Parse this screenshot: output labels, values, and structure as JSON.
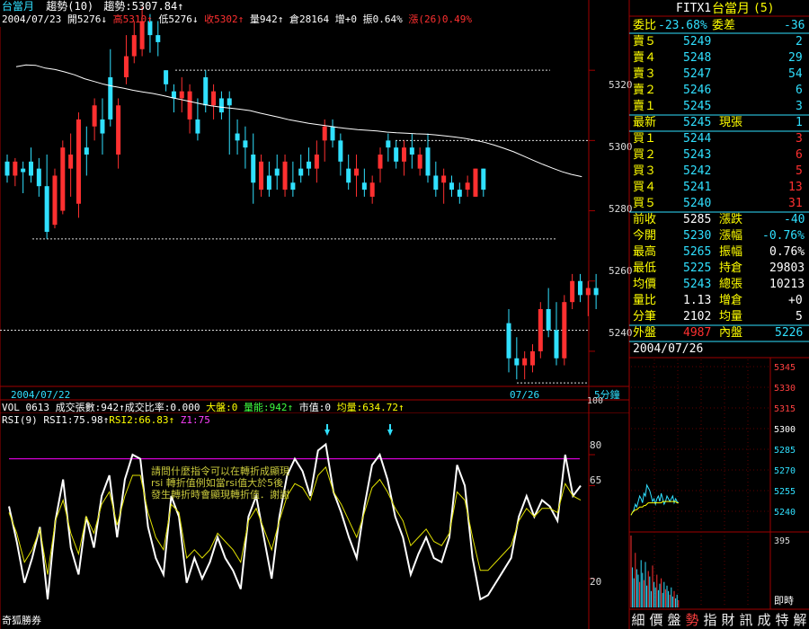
{
  "main_header": {
    "symbol": "台當月",
    "trend_label": "趨勢(10)",
    "trend_value": "趨勢:5307.84↑",
    "date": "2004/07/23",
    "open": "開5276↓",
    "high": "高5310↑",
    "low": "低5276↓",
    "close": "收5302↑",
    "volume": "量942↑",
    "oi": "倉28164",
    "oi_change": "增+0",
    "amplitude": "振0.64%",
    "change": "漲(26)0.49%"
  },
  "price_axis": [
    "5320",
    "5300",
    "5280",
    "5260",
    "5240"
  ],
  "date_axis": {
    "left": "2004/07/22",
    "right": "07/26",
    "period": "5分鐘",
    "top_tick": "100"
  },
  "volume_bar": {
    "code": "VOL 0613",
    "contracts": "成交張數:942↑",
    "ratio": "成交比率:0.000",
    "market": "大盤:0",
    "energy": "量能:942↑",
    "value": "市值:0",
    "avg": "均量:634.72↑"
  },
  "rsi_header": {
    "name": "RSI(9)",
    "rsi1": "RSI1:75.98↑",
    "rsi2": "RSI2:66.83↑",
    "z": "Z1:75"
  },
  "rsi_axis": [
    "80",
    "65",
    "20"
  ],
  "annotation": [
    "請問什麼指令可以在轉折成顯現",
    "rsi 轉折值例如當rsi值大於5後",
    "發生轉折時會顯現轉折值．謝謝"
  ],
  "footer_brand": "奇狐勝券",
  "quote": {
    "code": "FITX1",
    "name": "台當月",
    "count": "(5)",
    "ratio_label": "委比",
    "ratio_value": "-23.68%",
    "diff_label": "委差",
    "diff_value": "-36",
    "asks": [
      {
        "label": "賣５",
        "price": "5249",
        "qty": "2"
      },
      {
        "label": "賣４",
        "price": "5248",
        "qty": "29"
      },
      {
        "label": "賣３",
        "price": "5247",
        "qty": "54"
      },
      {
        "label": "賣２",
        "price": "5246",
        "qty": "6"
      },
      {
        "label": "賣１",
        "price": "5245",
        "qty": "3"
      }
    ],
    "last": {
      "label": "最新",
      "price": "5245",
      "qlabel": "現張",
      "qty": "1"
    },
    "bids": [
      {
        "label": "買１",
        "price": "5244",
        "qty": "3"
      },
      {
        "label": "買２",
        "price": "5243",
        "qty": "6"
      },
      {
        "label": "買３",
        "price": "5242",
        "qty": "5"
      },
      {
        "label": "買４",
        "price": "5241",
        "qty": "13"
      },
      {
        "label": "買５",
        "price": "5240",
        "qty": "31"
      }
    ],
    "stats": [
      {
        "l1": "前收",
        "v1": "5285",
        "l2": "漲跌",
        "v2": "-40"
      },
      {
        "l1": "今開",
        "v1": "5230",
        "l2": "漲幅",
        "v2": "-0.76%"
      },
      {
        "l1": "最高",
        "v1": "5265",
        "l2": "振幅",
        "v2": "0.76%"
      },
      {
        "l1": "最低",
        "v1": "5225",
        "l2": "持倉",
        "v2": "29803"
      },
      {
        "l1": "均價",
        "v1": "5243",
        "l2": "總張",
        "v2": "10213"
      },
      {
        "l1": "量比",
        "v1": "1.13",
        "l2": "增倉",
        "v2": "+0"
      },
      {
        "l1": "分筆",
        "v1": "2102",
        "l2": "均量",
        "v2": "5"
      }
    ],
    "outer_label": "外盤",
    "outer_value": "4987",
    "inner_label": "內盤",
    "inner_value": "5226",
    "date": "2004/07/26"
  },
  "mini_axis": [
    "5345",
    "5330",
    "5315",
    "5300",
    "5285",
    "5270",
    "5255",
    "5240"
  ],
  "mini_vol_axis": {
    "max": "395",
    "label": "即時"
  },
  "bottom_nav": [
    "細",
    "價",
    "盤",
    "勢",
    "指",
    "財",
    "訊",
    "成",
    "特",
    "解"
  ],
  "bottom_nav_active": 3,
  "colors": {
    "up": "#ff3030",
    "down": "#30e0ff",
    "ma": "#ffffff",
    "rsi1": "#ffffff",
    "rsi2": "#e0e000",
    "zline": "#ff00ff",
    "border": "#a00000"
  },
  "chart_data": [
    {
      "type": "candlestick",
      "title": "台當月 趨勢(10)",
      "ylim": [
        5230,
        5340
      ],
      "series": [
        {
          "name": "candles",
          "values": [
            [
              5294,
              5296,
              5288,
              5290
            ],
            [
              5290,
              5295,
              5287,
              5294
            ],
            [
              5292,
              5294,
              5285,
              5291
            ],
            [
              5294,
              5298,
              5288,
              5290
            ],
            [
              5292,
              5295,
              5284,
              5287
            ],
            [
              5287,
              5296,
              5272,
              5274
            ],
            [
              5276,
              5292,
              5275,
              5290
            ],
            [
              5280,
              5300,
              5279,
              5298
            ],
            [
              5292,
              5302,
              5284,
              5296
            ],
            [
              5282,
              5308,
              5278,
              5306
            ],
            [
              5298,
              5304,
              5290,
              5296
            ],
            [
              5304,
              5312,
              5300,
              5310
            ],
            [
              5306,
              5312,
              5296,
              5302
            ],
            [
              5318,
              5326,
              5304,
              5306
            ],
            [
              5296,
              5312,
              5292,
              5310
            ],
            [
              5318,
              5330,
              5316,
              5324
            ],
            [
              5324,
              5334,
              5322,
              5330
            ],
            [
              5326,
              5338,
              5324,
              5334
            ],
            [
              5334,
              5336,
              5325,
              5330
            ],
            [
              5330,
              5334,
              5324,
              5328
            ],
            [
              5320,
              5320,
              5314,
              5316
            ],
            [
              5314,
              5316,
              5308,
              5312
            ],
            [
              5312,
              5318,
              5308,
              5314
            ],
            [
              5306,
              5316,
              5302,
              5314
            ],
            [
              5306,
              5312,
              5300,
              5302
            ],
            [
              5318,
              5320,
              5308,
              5310
            ],
            [
              5310,
              5316,
              5306,
              5314
            ],
            [
              5312,
              5314,
              5306,
              5308
            ],
            [
              5312,
              5314,
              5296,
              5310
            ],
            [
              5302,
              5306,
              5296,
              5300
            ],
            [
              5300,
              5304,
              5292,
              5298
            ],
            [
              5296,
              5302,
              5282,
              5288
            ],
            [
              5286,
              5296,
              5284,
              5294
            ],
            [
              5290,
              5294,
              5284,
              5286
            ],
            [
              5292,
              5296,
              5286,
              5290
            ],
            [
              5286,
              5296,
              5284,
              5294
            ],
            [
              5288,
              5294,
              5284,
              5286
            ],
            [
              5292,
              5296,
              5288,
              5290
            ],
            [
              5294,
              5298,
              5290,
              5292
            ],
            [
              5292,
              5300,
              5288,
              5296
            ],
            [
              5300,
              5306,
              5294,
              5304
            ],
            [
              5304,
              5306,
              5298,
              5300
            ],
            [
              5300,
              5302,
              5290,
              5294
            ],
            [
              5292,
              5296,
              5286,
              5288
            ],
            [
              5290,
              5296,
              5284,
              5292
            ],
            [
              5288,
              5292,
              5284,
              5286
            ],
            [
              5284,
              5290,
              5282,
              5288
            ],
            [
              5292,
              5298,
              5288,
              5296
            ],
            [
              5300,
              5302,
              5294,
              5298
            ],
            [
              5298,
              5300,
              5292,
              5294
            ],
            [
              5294,
              5300,
              5290,
              5298
            ],
            [
              5298,
              5302,
              5292,
              5296
            ],
            [
              5292,
              5298,
              5290,
              5296
            ],
            [
              5298,
              5302,
              5288,
              5290
            ],
            [
              5290,
              5294,
              5284,
              5286
            ],
            [
              5288,
              5292,
              5282,
              5290
            ],
            [
              5288,
              5290,
              5284,
              5286
            ],
            [
              5286,
              5288,
              5282,
              5284
            ],
            [
              5286,
              5290,
              5284,
              5288
            ],
            [
              5284,
              5292,
              5284,
              5292
            ],
            [
              5292,
              5292,
              5284,
              5286
            ],
            [
              5248,
              5252,
              5234,
              5238
            ],
            [
              5238,
              5244,
              5232,
              5236
            ],
            [
              5236,
              5240,
              5232,
              5238
            ],
            [
              5236,
              5242,
              5234,
              5240
            ],
            [
              5240,
              5254,
              5238,
              5252
            ],
            [
              5252,
              5258,
              5244,
              5246
            ],
            [
              5246,
              5254,
              5236,
              5238
            ],
            [
              5238,
              5256,
              5236,
              5254
            ],
            [
              5254,
              5262,
              5252,
              5260
            ],
            [
              5260,
              5262,
              5254,
              5256
            ],
            [
              5256,
              5260,
              5250,
              5258
            ],
            [
              5258,
              5262,
              5252,
              5256
            ]
          ]
        },
        {
          "name": "trend",
          "values": [
            5321,
            5321.5,
            5321.4,
            5320.6,
            5320.2,
            5319.5,
            5318.7,
            5317.6,
            5316.8,
            5316,
            5315.4,
            5314.9,
            5314.3,
            5313.8,
            5313.4,
            5312.8,
            5312.2,
            5311.6,
            5311,
            5310.4,
            5309.9,
            5309.5,
            5309.2,
            5308.9,
            5308.5,
            5307.8,
            5307.2,
            5306.6,
            5305.9,
            5305.4,
            5304.9,
            5304.5,
            5304.1,
            5303.7,
            5303.4,
            5303.1,
            5302.9,
            5302.7,
            5302.4,
            5302.2,
            5302.1,
            5301.9,
            5301.8,
            5301.6,
            5301.3,
            5301,
            5300.6,
            5300.1,
            5299.5,
            5298.7,
            5297.8,
            5296.8,
            5295.6,
            5294.4,
            5293.2,
            5292.1,
            5291.1,
            5290.3,
            5289.7
          ]
        }
      ]
    },
    {
      "type": "line",
      "title": "RSI(9)",
      "ylim": [
        0,
        100
      ],
      "series": [
        {
          "name": "RSI1",
          "values": [
            55,
            38,
            18,
            30,
            45,
            10,
            48,
            68,
            35,
            22,
            50,
            35,
            60,
            70,
            40,
            68,
            80,
            78,
            45,
            30,
            22,
            60,
            50,
            18,
            30,
            20,
            28,
            40,
            30,
            24,
            15,
            50,
            60,
            40,
            20,
            50,
            70,
            78,
            72,
            60,
            82,
            85,
            62,
            52,
            40,
            30,
            55,
            75,
            80,
            68,
            50,
            40,
            22,
            32,
            40,
            30,
            28,
            40,
            75,
            65,
            30,
            10,
            12,
            18,
            24,
            30,
            50,
            60,
            50,
            58,
            55,
            48,
            80,
            60,
            65
          ]
        },
        {
          "name": "RSI2",
          "values": [
            52,
            42,
            28,
            34,
            44,
            22,
            48,
            58,
            42,
            32,
            50,
            42,
            56,
            62,
            46,
            60,
            70,
            70,
            52,
            40,
            34,
            56,
            52,
            30,
            34,
            30,
            34,
            42,
            38,
            34,
            28,
            48,
            54,
            44,
            34,
            48,
            60,
            66,
            64,
            58,
            70,
            74,
            62,
            56,
            48,
            40,
            52,
            64,
            68,
            62,
            54,
            48,
            36,
            40,
            44,
            38,
            36,
            42,
            62,
            58,
            40,
            24,
            24,
            28,
            32,
            36,
            48,
            54,
            50,
            54,
            54,
            52,
            66,
            60,
            58
          ]
        }
      ],
      "annotations": [
        "z-line 75"
      ]
    },
    {
      "type": "line",
      "title": "FITX1 即時",
      "ylim": [
        5225,
        5350
      ],
      "series": [
        {
          "name": "price",
          "values": [
            5236,
            5238,
            5240,
            5244,
            5242,
            5246,
            5250,
            5248,
            5245,
            5252,
            5250,
            5258,
            5256,
            5254,
            5250,
            5246,
            5248,
            5244,
            5248,
            5250,
            5246,
            5252,
            5248,
            5244,
            5246,
            5250,
            5248,
            5246,
            5248,
            5250,
            5245,
            5248,
            5246,
            5245
          ]
        },
        {
          "name": "avg",
          "values": [
            5236,
            5238,
            5239,
            5240,
            5240,
            5241,
            5242,
            5242,
            5242,
            5243,
            5243,
            5244,
            5245,
            5245,
            5245,
            5245,
            5245,
            5245,
            5245,
            5245,
            5245,
            5245,
            5246,
            5246,
            5246,
            5246,
            5246,
            5246,
            5246,
            5246,
            5246,
            5246,
            5245,
            5245
          ]
        },
        {
          "name": "volume",
          "values": [
            395,
            220,
            160,
            300,
            210,
            180,
            140,
            260,
            190,
            150,
            250,
            120,
            200,
            170,
            90,
            230,
            140,
            110,
            180,
            95,
            130,
            160,
            80,
            140,
            100,
            120,
            90,
            70,
            110,
            60,
            90,
            50,
            70,
            40
          ]
        }
      ]
    }
  ]
}
